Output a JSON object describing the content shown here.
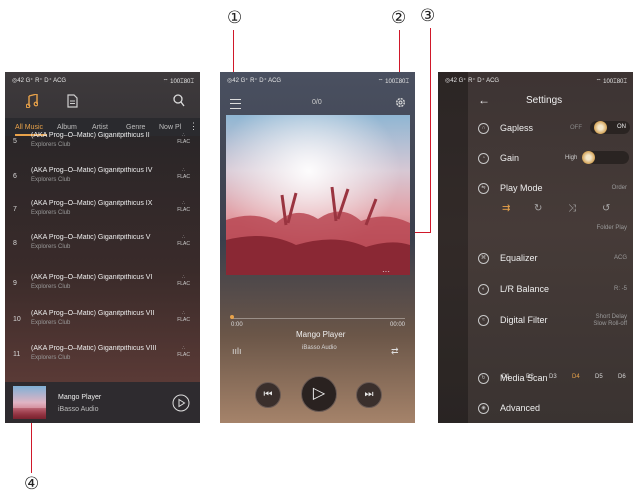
{
  "callouts": {
    "c1": "①",
    "c2": "②",
    "c3": "③",
    "c4": "④"
  },
  "status": {
    "left": "◎42 G⁺ R⁺ D⁺ ACG",
    "right": "⌔ 100⌶80⌶"
  },
  "library": {
    "tabs": [
      "All Music",
      "Album",
      "Artist",
      "Genre",
      "Now Pl"
    ],
    "rows": [
      {
        "num": "5",
        "title": "(AKA Prog–O–Matic) Giganitpithicus II",
        "artist": "Explorers Club",
        "format": "FLAC"
      },
      {
        "num": "6",
        "title": "(AKA Prog–O–Matic) Giganitpithicus IV",
        "artist": "Explorers Club",
        "format": "FLAC"
      },
      {
        "num": "7",
        "title": "(AKA Prog–O–Matic) Giganitpithicus IX",
        "artist": "Explorers Club",
        "format": "FLAC"
      },
      {
        "num": "8",
        "title": "(AKA Prog–O–Matic) Giganitpithicus V",
        "artist": "Explorers Club",
        "format": "FLAC"
      },
      {
        "num": "9",
        "title": "(AKA Prog–O–Matic) Giganitpithicus VI",
        "artist": "Explorers Club",
        "format": "FLAC"
      },
      {
        "num": "10",
        "title": "(AKA Prog–O–Matic) Giganitpithicus VII",
        "artist": "Explorers Club",
        "format": "FLAC"
      },
      {
        "num": "11",
        "title": "(AKA Prog–O–Matic) Giganitpithicus VIII",
        "artist": "Explorers Club",
        "format": "FLAC"
      }
    ],
    "mini_title": "Mango Player",
    "mini_artist": "iBasso Audio"
  },
  "player": {
    "counter": "0/0",
    "time_start": "0:00",
    "time_end": "00:00",
    "title": "Mango Player",
    "artist": "iBasso Audio",
    "progress": 0
  },
  "settings": {
    "title": "Settings",
    "gapless": {
      "label": "Gapless",
      "off": "OFF",
      "on": "ON"
    },
    "gain": {
      "label": "Gain",
      "value": "High"
    },
    "play_mode": {
      "label": "Play Mode",
      "value": "Order",
      "sub": "Folder Play"
    },
    "equalizer": {
      "label": "Equalizer",
      "value": "ACG"
    },
    "balance": {
      "label": "L/R Balance",
      "value": "R: -5"
    },
    "digital_filter": {
      "label": "Digital Filter",
      "value1": "Short Delay",
      "value2": "Slow Roll-off",
      "options": [
        "D1",
        "D2",
        "D3",
        "D4",
        "D5",
        "D6"
      ],
      "selected": "D4"
    },
    "media_scan": {
      "label": "Media Scan"
    },
    "advanced": {
      "label": "Advanced"
    }
  },
  "colors": {
    "accent": "#e8a24a",
    "callout_line": "#d0182a"
  }
}
